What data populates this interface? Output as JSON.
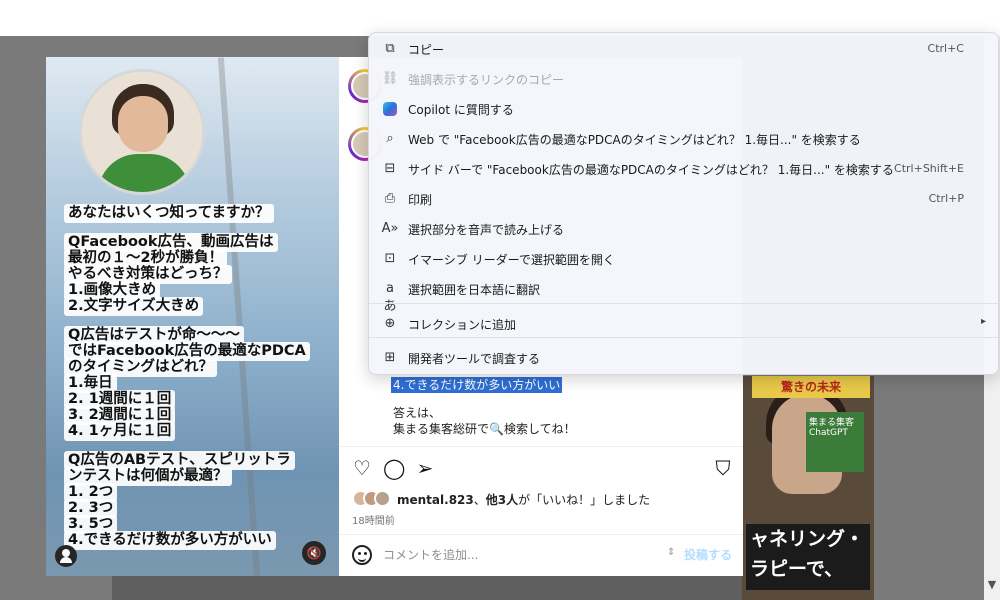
{
  "post_text": {
    "lines": [
      "あなたはいくつ知ってますか？",
      "",
      "QFacebook広告、動画広告は",
      "最初の１～2秒が勝負！",
      "やるべき対策はどっち？",
      "1.画像大きめ",
      "2.文字サイズ大きめ",
      "",
      "Q広告はテストが命～～～",
      "ではFacebook広告の最適なPDCA",
      "のタイミングはどれ？",
      "1.毎日",
      "2. 1週間に１回",
      "3. 2週間に１回",
      "4. 1ヶ月に１回",
      "",
      "Q広告のABテスト、スピリットラ",
      "ンテストは何個が最適？",
      "1. 2つ",
      "2. 3つ",
      "3. 5つ",
      "4.できるだけ数が多い方がいい"
    ]
  },
  "caption": {
    "highlighted": "4.できるだけ数が多い方がいい",
    "answer_line1": "答えは、",
    "answer_line2": "集まる集客総研で🔍検索してね！"
  },
  "actions": {
    "heart_glyph": "♡",
    "comment_glyph": "◯",
    "share_glyph": "➢",
    "bookmark_glyph": "⛉"
  },
  "likes": {
    "user": "mental.823",
    "others": "他3人",
    "suffix": "が「いいね！」しました",
    "time_ago": "18時間前"
  },
  "comment": {
    "placeholder": "コメントを追加...",
    "post_label": "投稿する"
  },
  "right_thumb": {
    "banner": "驚きの未来",
    "caption_line1": "ャネリング・",
    "caption_line2": "ラピーで、",
    "tag": "集まる集客 ChatGPT"
  },
  "context_menu": {
    "items": [
      {
        "icon": "⧉",
        "label": "コピー",
        "shortcut": "Ctrl+C",
        "disabled": false
      },
      {
        "icon": "⛓",
        "label": "強調表示するリンクのコピー",
        "shortcut": "",
        "disabled": true
      },
      {
        "icon": "",
        "label": "Copilot に質問する",
        "shortcut": "",
        "disabled": false
      },
      {
        "icon": "⌕",
        "label": "Web で \"Facebook広告の最適なPDCAのタイミングはどれ？ 1.毎日...\" を検索する",
        "shortcut": "",
        "disabled": false
      },
      {
        "icon": "⊟",
        "label": "サイド バーで \"Facebook広告の最適なPDCAのタイミングはどれ？ 1.毎日...\" を検索する",
        "shortcut": "Ctrl+Shift+E",
        "disabled": false
      },
      {
        "icon": "⎙",
        "label": "印刷",
        "shortcut": "Ctrl+P",
        "disabled": false
      },
      {
        "icon": "A»",
        "label": "選択部分を音声で読み上げる",
        "shortcut": "",
        "disabled": false
      },
      {
        "icon": "⊡",
        "label": "イマーシブ リーダーで選択範囲を開く",
        "shortcut": "",
        "disabled": false
      },
      {
        "icon": "aあ",
        "label": "選択範囲を日本語に翻訳",
        "shortcut": "",
        "disabled": false
      },
      {
        "icon": "⊕",
        "label": "コレクションに追加",
        "shortcut": "",
        "disabled": false
      },
      {
        "icon": "⊞",
        "label": "開発者ツールで調査する",
        "shortcut": "",
        "disabled": false
      }
    ],
    "submenu_arrow": "▸"
  },
  "media": {
    "mute_glyph": "🔇"
  },
  "scrollbar": {
    "down_arrow": "▼"
  }
}
